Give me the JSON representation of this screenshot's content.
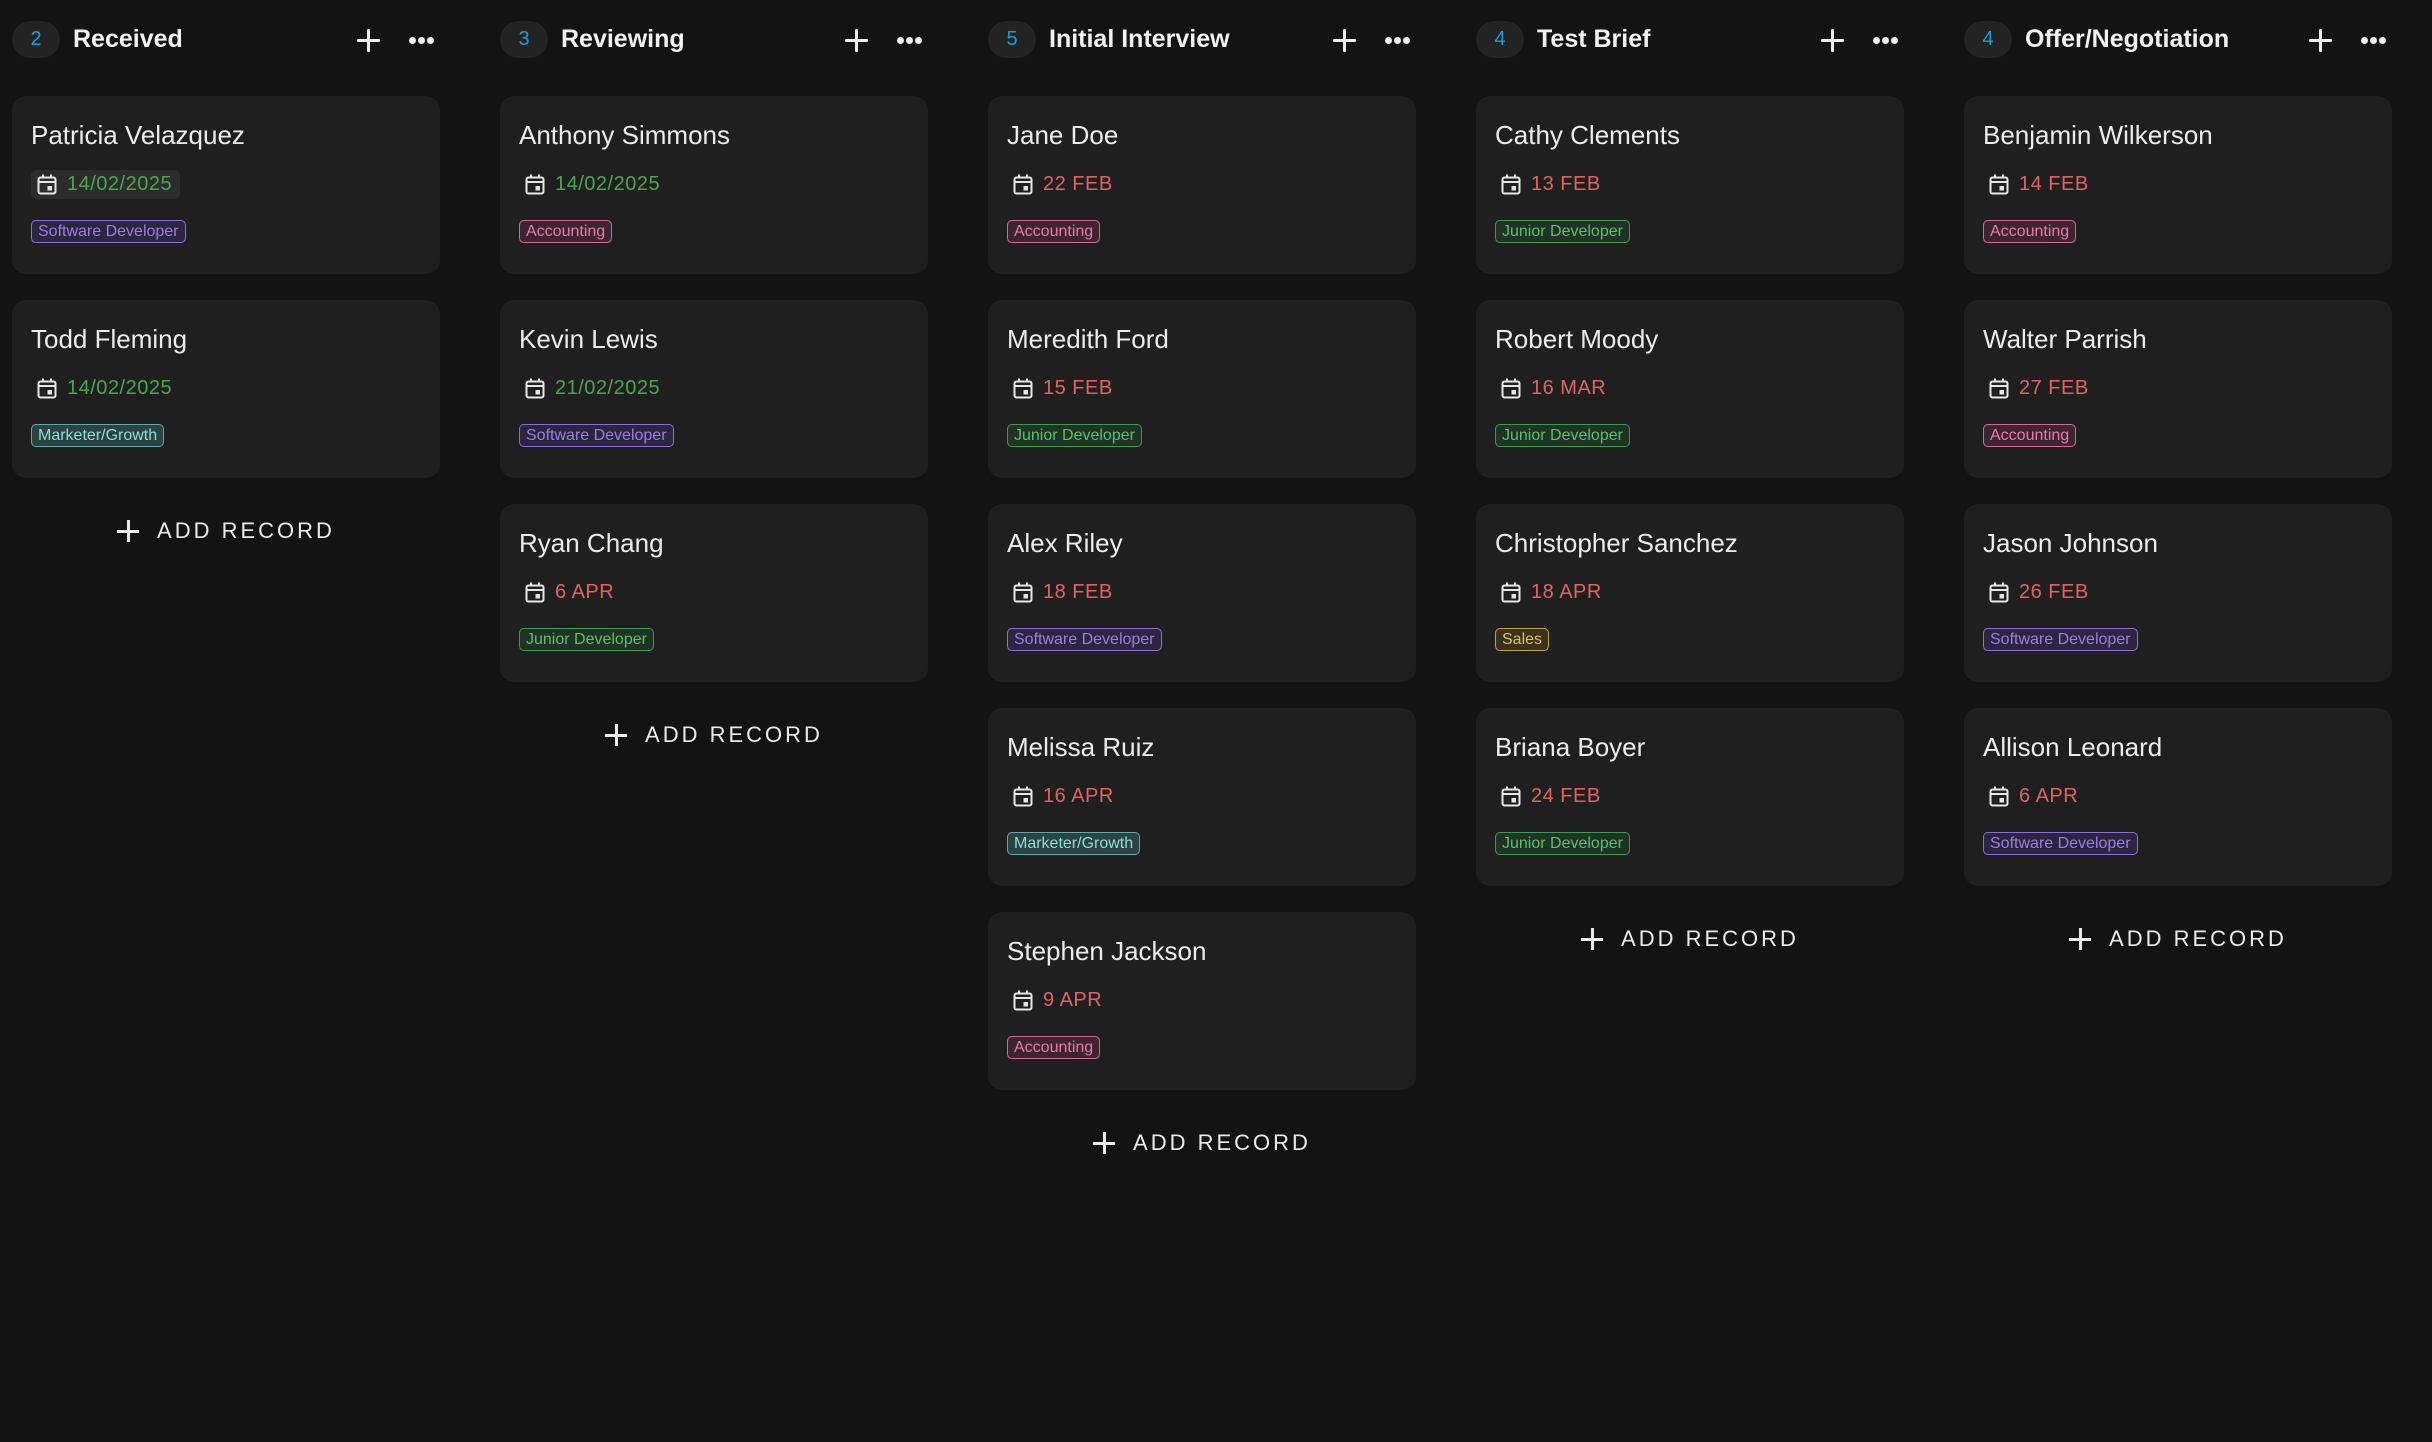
{
  "colors": {
    "background": "#131313",
    "card": "#1f1f1f",
    "count_badge_text": "#1f9ad6",
    "date_on_time": "#46a84e",
    "date_overdue": "#e0635f"
  },
  "tag_styles": {
    "Software Developer": {
      "color": "#9b7fe0",
      "border": "#8a6fd6",
      "bg": "#2b2540"
    },
    "Marketer/Growth": {
      "color": "#8fdede",
      "border": "#5fa8a8",
      "bg": "#2a4242"
    },
    "Accounting": {
      "color": "#e87aa8",
      "border": "#d06a96",
      "bg": "#3e2431"
    },
    "Junior Developer": {
      "color": "#56c26a",
      "border": "#3f9b52",
      "bg": "#1f3324"
    },
    "Sales": {
      "color": "#e0c052",
      "border": "#bfa043",
      "bg": "#3a321a"
    }
  },
  "add_record_label": "ADD RECORD",
  "columns": [
    {
      "title": "Received",
      "count": "2",
      "cards": [
        {
          "name": "Patricia Velazquez",
          "date": "14/02/2025",
          "date_status": "green",
          "date_hover": true,
          "tag": "Software Developer"
        },
        {
          "name": "Todd Fleming",
          "date": "14/02/2025",
          "date_status": "green",
          "tag": "Marketer/Growth"
        }
      ]
    },
    {
      "title": "Reviewing",
      "count": "3",
      "cards": [
        {
          "name": "Anthony Simmons",
          "date": "14/02/2025",
          "date_status": "green",
          "tag": "Accounting"
        },
        {
          "name": "Kevin Lewis",
          "date": "21/02/2025",
          "date_status": "green",
          "tag": "Software Developer"
        },
        {
          "name": "Ryan Chang",
          "date": "6 APR",
          "date_status": "red",
          "tag": "Junior Developer"
        }
      ]
    },
    {
      "title": "Initial Interview",
      "count": "5",
      "cards": [
        {
          "name": "Jane Doe",
          "date": "22 FEB",
          "date_status": "red",
          "tag": "Accounting"
        },
        {
          "name": "Meredith Ford",
          "date": "15 FEB",
          "date_status": "red",
          "tag": "Junior Developer"
        },
        {
          "name": "Alex Riley",
          "date": "18 FEB",
          "date_status": "red",
          "tag": "Software Developer"
        },
        {
          "name": "Melissa Ruiz",
          "date": "16 APR",
          "date_status": "red",
          "tag": "Marketer/Growth"
        },
        {
          "name": "Stephen Jackson",
          "date": "9 APR",
          "date_status": "red",
          "tag": "Accounting"
        }
      ]
    },
    {
      "title": "Test Brief",
      "count": "4",
      "cards": [
        {
          "name": "Cathy Clements",
          "date": "13 FEB",
          "date_status": "red",
          "tag": "Junior Developer"
        },
        {
          "name": "Robert Moody",
          "date": "16 MAR",
          "date_status": "red",
          "tag": "Junior Developer"
        },
        {
          "name": "Christopher Sanchez",
          "date": "18 APR",
          "date_status": "red",
          "tag": "Sales"
        },
        {
          "name": "Briana Boyer",
          "date": "24 FEB",
          "date_status": "red",
          "tag": "Junior Developer"
        }
      ]
    },
    {
      "title": "Offer/Negotiation",
      "count": "4",
      "cards": [
        {
          "name": "Benjamin Wilkerson",
          "date": "14 FEB",
          "date_status": "red",
          "tag": "Accounting"
        },
        {
          "name": "Walter Parrish",
          "date": "27 FEB",
          "date_status": "red",
          "tag": "Accounting"
        },
        {
          "name": "Jason Johnson",
          "date": "26 FEB",
          "date_status": "red",
          "tag": "Software Developer"
        },
        {
          "name": "Allison Leonard",
          "date": "6 APR",
          "date_status": "red",
          "tag": "Software Developer"
        }
      ]
    }
  ]
}
